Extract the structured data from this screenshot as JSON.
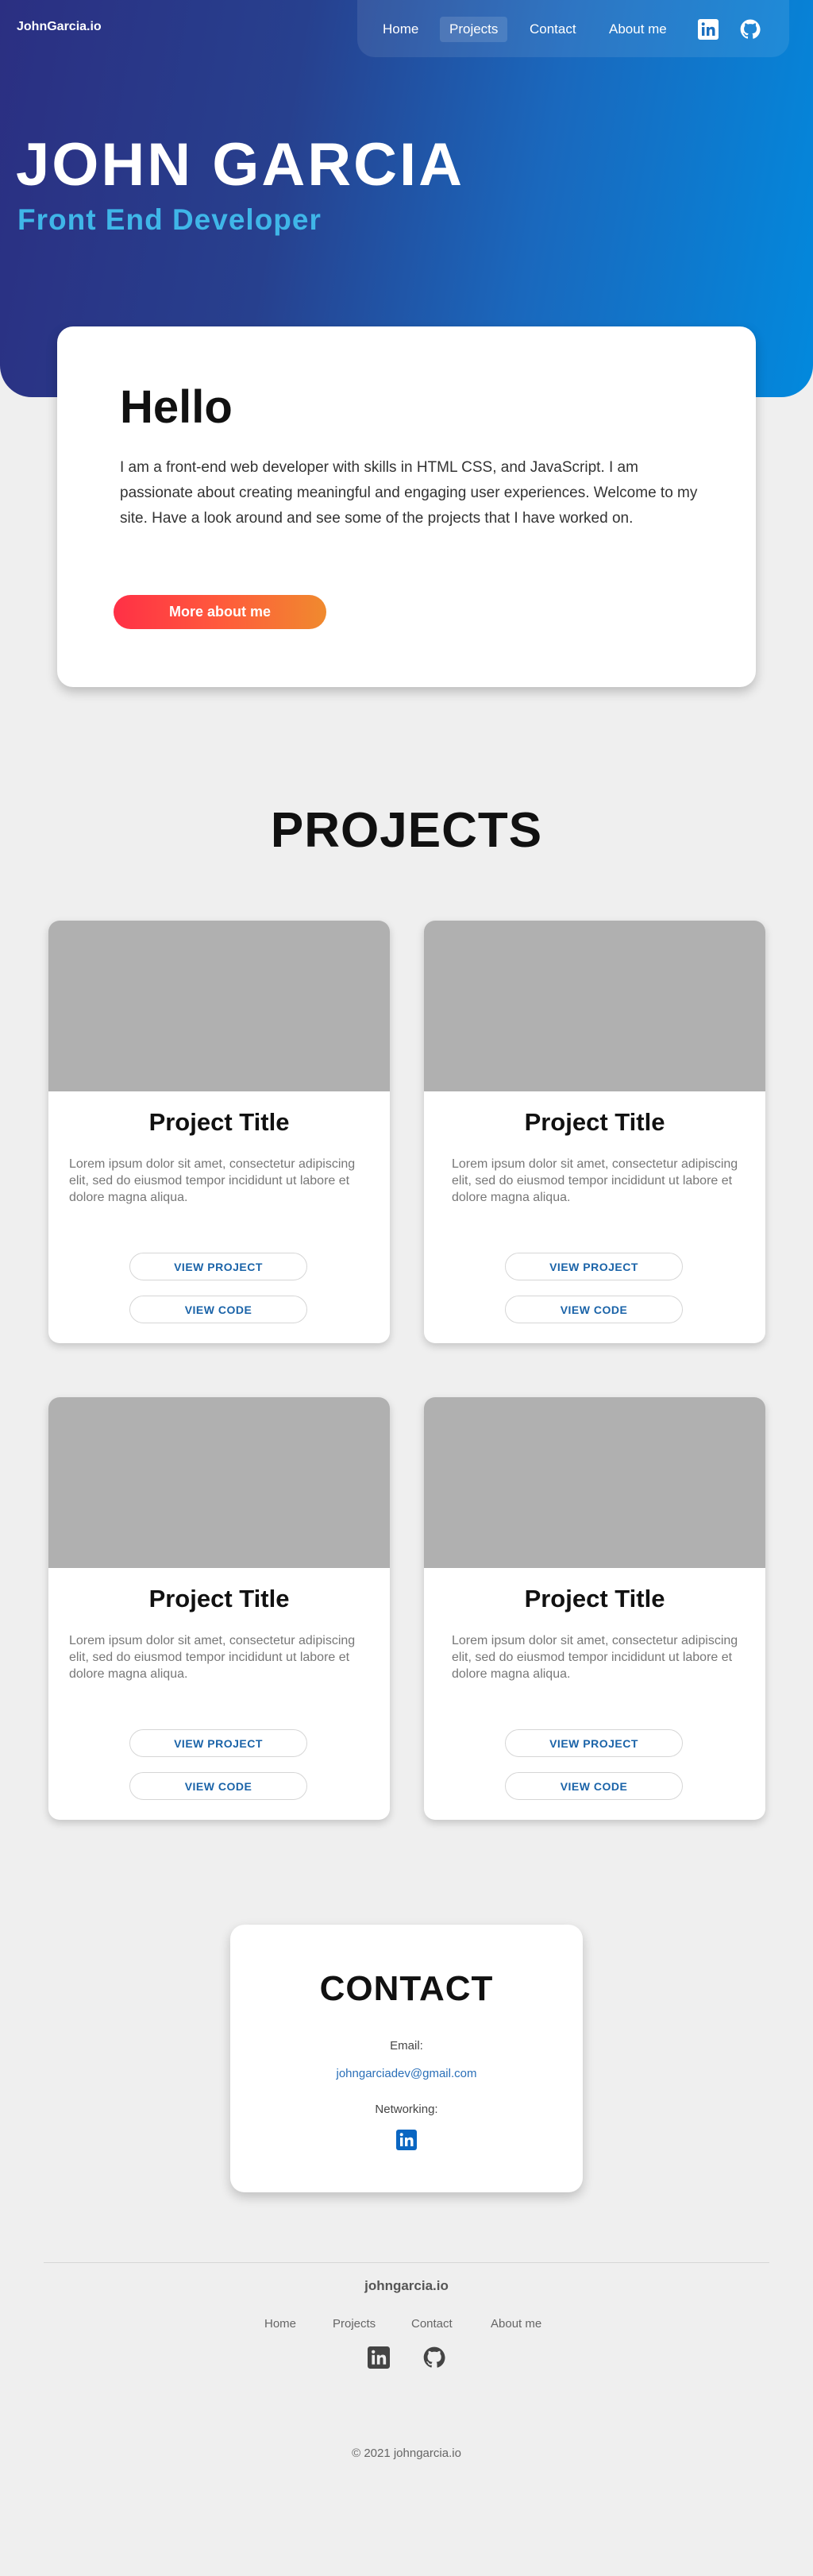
{
  "header": {
    "brand": "JohnGarcia.io",
    "nav": [
      "Home",
      "Projects",
      "Contact",
      "About me"
    ],
    "icons": [
      "linkedin-icon",
      "github-icon"
    ]
  },
  "hero": {
    "name": "JOHN GARCIA",
    "role": "Front End Developer"
  },
  "about": {
    "title": "Hello",
    "text": "I am a front-end web developer with skills in HTML CSS, and JavaScript.  I am passionate about creating meaningful and engaging user experiences. Welcome to my site.  Have a look around and see some of the projects that I have worked on.",
    "button": "More about me"
  },
  "projects": {
    "title": "PROJECTS",
    "items": [
      {
        "title": "Project Title",
        "desc": "Lorem ipsum dolor sit amet, consectetur adipiscing elit, sed do eiusmod tempor incididunt ut labore et dolore magna aliqua.",
        "view_project": "VIEW PROJECT",
        "view_code": "VIEW CODE"
      },
      {
        "title": "Project Title",
        "desc": "Lorem ipsum dolor sit amet, consectetur adipiscing elit, sed do eiusmod tempor incididunt ut labore et dolore magna aliqua.",
        "view_project": "VIEW PROJECT",
        "view_code": "VIEW CODE"
      },
      {
        "title": "Project Title",
        "desc": "Lorem ipsum dolor sit amet, consectetur adipiscing elit, sed do eiusmod tempor incididunt ut labore et dolore magna aliqua.",
        "view_project": "VIEW PROJECT",
        "view_code": "VIEW CODE"
      },
      {
        "title": "Project Title",
        "desc": "Lorem ipsum dolor sit amet, consectetur adipiscing elit, sed do eiusmod tempor incididunt ut labore et dolore magna aliqua.",
        "view_project": "VIEW PROJECT",
        "view_code": "VIEW CODE"
      }
    ]
  },
  "contact": {
    "title": "CONTACT",
    "email_label": "Email:",
    "email": "johngarciadev@gmail.com",
    "networking_label": "Networking:"
  },
  "footer": {
    "brand": "johngarcia.io",
    "nav": [
      "Home",
      "Projects",
      "Contact",
      "About me"
    ],
    "copyright": "© 2021 johngarcia.io"
  },
  "colors": {
    "hero_start": "#2b2f82",
    "hero_end": "#0289dd",
    "accent_role": "#3fb6e8",
    "button_start": "#ff3046",
    "button_end": "#f08a2e",
    "link_blue": "#1a63a8",
    "linkedin": "#0a66c2"
  }
}
